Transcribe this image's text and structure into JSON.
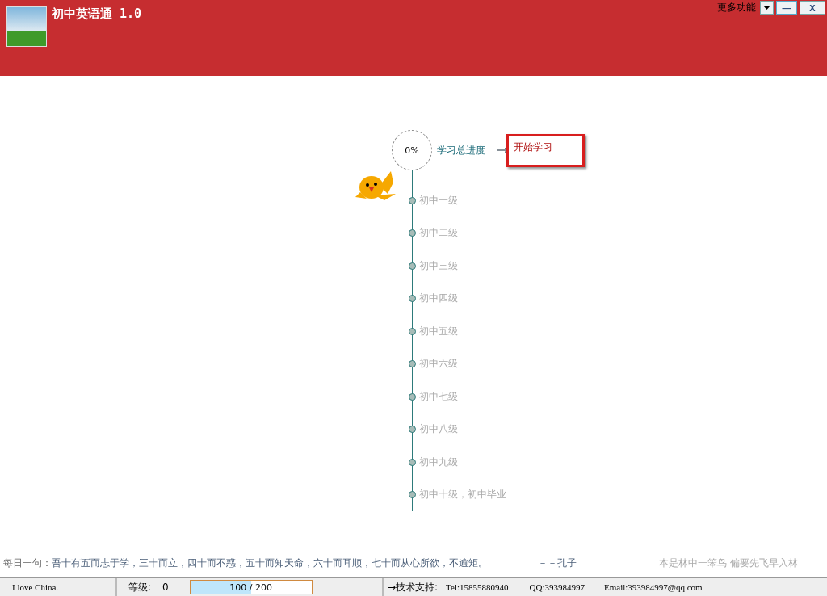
{
  "window": {
    "title": "初中英语通 1.0",
    "more_label": "更多功能",
    "controls": [
      {
        "kind": "dropdown"
      },
      {
        "kind": "minimize",
        "label": "—"
      },
      {
        "kind": "close",
        "label": "X"
      }
    ]
  },
  "progress": {
    "percent": "0%",
    "label": "学习总进度",
    "start_button": "开始学习"
  },
  "levels": [
    {
      "name": "初中一级",
      "unlocked": false,
      "current": true
    },
    {
      "name": "初中二级",
      "unlocked": false,
      "current": false
    },
    {
      "name": "初中三级",
      "unlocked": false,
      "current": false
    },
    {
      "name": "初中四级",
      "unlocked": false,
      "current": false
    },
    {
      "name": "初中五级",
      "unlocked": false,
      "current": false
    },
    {
      "name": "初中六级",
      "unlocked": false,
      "current": false
    },
    {
      "name": "初中七级",
      "unlocked": false,
      "current": false
    },
    {
      "name": "初中八级",
      "unlocked": false,
      "current": false
    },
    {
      "name": "初中九级",
      "unlocked": false,
      "current": false
    },
    {
      "name": "初中十级，初中毕业",
      "unlocked": false,
      "current": false
    }
  ],
  "daily": {
    "label": "每日一句：",
    "quote": "吾十有五而志于学，三十而立，四十而不惑，五十而知天命，六十而耳顺，七十而从心所欲，不逾矩。",
    "author": "－－孔子",
    "motto": "本是林中一笨鸟 偏要先飞早入林"
  },
  "status_bar": {
    "slogan": "I love China.",
    "grade_label": "等级:",
    "grade": "0",
    "exp": {
      "text": "100 / 200",
      "level": 0.5
    },
    "support": "→技术支持:",
    "tel": "Tel:15855880940",
    "qq": "QQ:393984997",
    "email": "Email:393984997@qq.com"
  }
}
